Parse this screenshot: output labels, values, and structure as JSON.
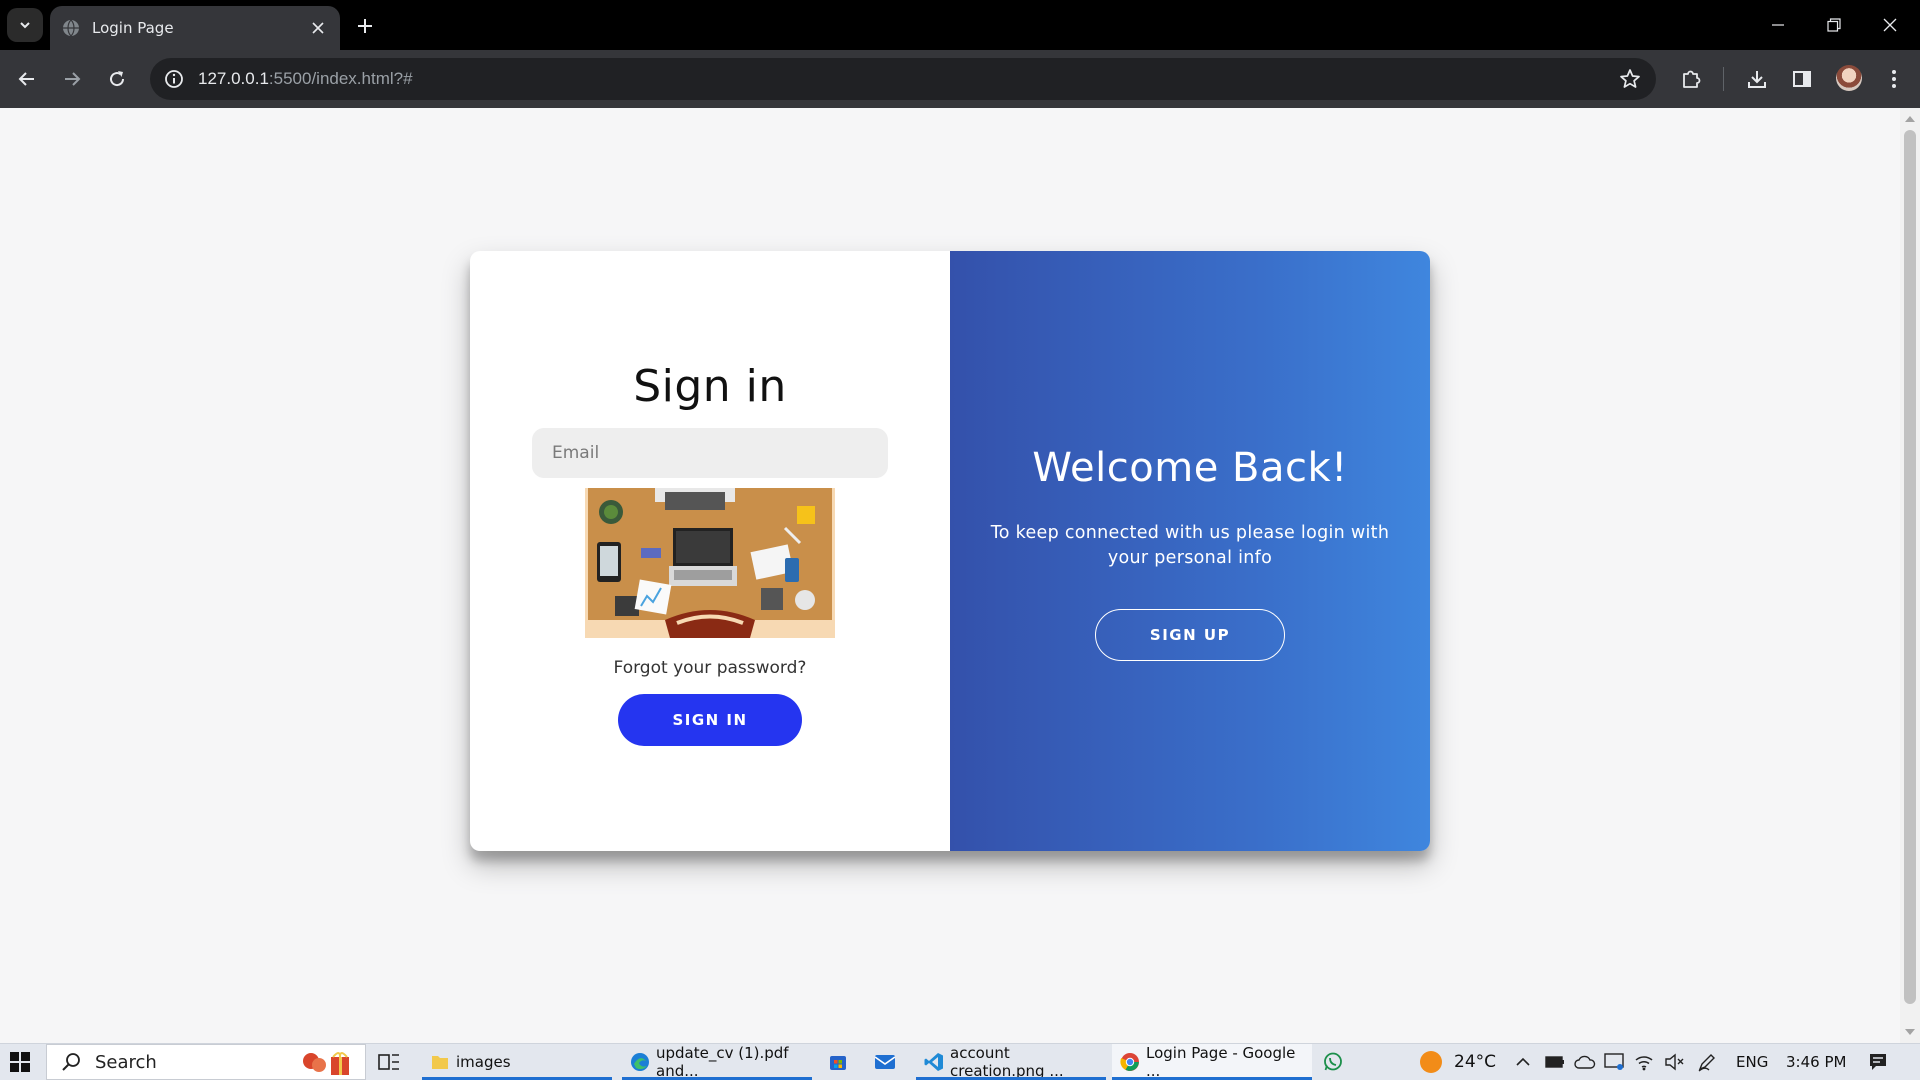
{
  "browser": {
    "tab_title": "Login Page",
    "url_host": "127.0.0.1",
    "url_rest": ":5500/index.html?#"
  },
  "page": {
    "signin": {
      "heading": "Sign in",
      "email_placeholder": "Email",
      "forgot_link": "Forgot your password?",
      "button": "SIGN IN"
    },
    "overlay": {
      "heading": "Welcome Back!",
      "text": "To keep connected with us please login with your personal info",
      "button": "SIGN UP"
    }
  },
  "taskbar": {
    "search": "Search",
    "items": [
      {
        "label": "images",
        "icon": "folder-icon"
      },
      {
        "label": "update_cv (1).pdf and...",
        "icon": "edge-icon"
      },
      {
        "label": "account creation.png ...",
        "icon": "vscode-icon"
      },
      {
        "label": "Login Page - Google ...",
        "icon": "chrome-icon"
      }
    ],
    "weather": "24°C",
    "language": "ENG",
    "time": "3:46 PM"
  },
  "colors": {
    "signin_button": "#2535f0",
    "overlay_gradient_start": "#3451ab",
    "overlay_gradient_end": "#3f86de"
  }
}
